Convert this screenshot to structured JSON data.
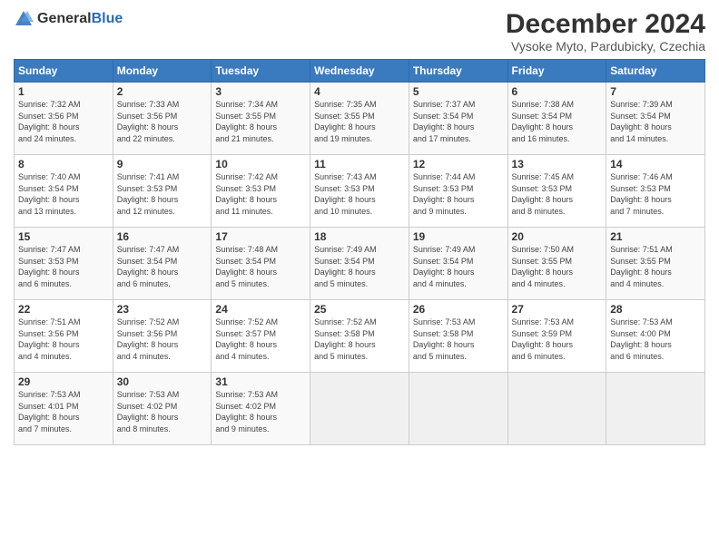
{
  "logo": {
    "general": "General",
    "blue": "Blue"
  },
  "title": {
    "main": "December 2024",
    "sub": "Vysoke Myto, Pardubicky, Czechia"
  },
  "headers": [
    "Sunday",
    "Monday",
    "Tuesday",
    "Wednesday",
    "Thursday",
    "Friday",
    "Saturday"
  ],
  "weeks": [
    [
      {
        "day": "1",
        "info": "Sunrise: 7:32 AM\nSunset: 3:56 PM\nDaylight: 8 hours\nand 24 minutes."
      },
      {
        "day": "2",
        "info": "Sunrise: 7:33 AM\nSunset: 3:56 PM\nDaylight: 8 hours\nand 22 minutes."
      },
      {
        "day": "3",
        "info": "Sunrise: 7:34 AM\nSunset: 3:55 PM\nDaylight: 8 hours\nand 21 minutes."
      },
      {
        "day": "4",
        "info": "Sunrise: 7:35 AM\nSunset: 3:55 PM\nDaylight: 8 hours\nand 19 minutes."
      },
      {
        "day": "5",
        "info": "Sunrise: 7:37 AM\nSunset: 3:54 PM\nDaylight: 8 hours\nand 17 minutes."
      },
      {
        "day": "6",
        "info": "Sunrise: 7:38 AM\nSunset: 3:54 PM\nDaylight: 8 hours\nand 16 minutes."
      },
      {
        "day": "7",
        "info": "Sunrise: 7:39 AM\nSunset: 3:54 PM\nDaylight: 8 hours\nand 14 minutes."
      }
    ],
    [
      {
        "day": "8",
        "info": "Sunrise: 7:40 AM\nSunset: 3:54 PM\nDaylight: 8 hours\nand 13 minutes."
      },
      {
        "day": "9",
        "info": "Sunrise: 7:41 AM\nSunset: 3:53 PM\nDaylight: 8 hours\nand 12 minutes."
      },
      {
        "day": "10",
        "info": "Sunrise: 7:42 AM\nSunset: 3:53 PM\nDaylight: 8 hours\nand 11 minutes."
      },
      {
        "day": "11",
        "info": "Sunrise: 7:43 AM\nSunset: 3:53 PM\nDaylight: 8 hours\nand 10 minutes."
      },
      {
        "day": "12",
        "info": "Sunrise: 7:44 AM\nSunset: 3:53 PM\nDaylight: 8 hours\nand 9 minutes."
      },
      {
        "day": "13",
        "info": "Sunrise: 7:45 AM\nSunset: 3:53 PM\nDaylight: 8 hours\nand 8 minutes."
      },
      {
        "day": "14",
        "info": "Sunrise: 7:46 AM\nSunset: 3:53 PM\nDaylight: 8 hours\nand 7 minutes."
      }
    ],
    [
      {
        "day": "15",
        "info": "Sunrise: 7:47 AM\nSunset: 3:53 PM\nDaylight: 8 hours\nand 6 minutes."
      },
      {
        "day": "16",
        "info": "Sunrise: 7:47 AM\nSunset: 3:54 PM\nDaylight: 8 hours\nand 6 minutes."
      },
      {
        "day": "17",
        "info": "Sunrise: 7:48 AM\nSunset: 3:54 PM\nDaylight: 8 hours\nand 5 minutes."
      },
      {
        "day": "18",
        "info": "Sunrise: 7:49 AM\nSunset: 3:54 PM\nDaylight: 8 hours\nand 5 minutes."
      },
      {
        "day": "19",
        "info": "Sunrise: 7:49 AM\nSunset: 3:54 PM\nDaylight: 8 hours\nand 4 minutes."
      },
      {
        "day": "20",
        "info": "Sunrise: 7:50 AM\nSunset: 3:55 PM\nDaylight: 8 hours\nand 4 minutes."
      },
      {
        "day": "21",
        "info": "Sunrise: 7:51 AM\nSunset: 3:55 PM\nDaylight: 8 hours\nand 4 minutes."
      }
    ],
    [
      {
        "day": "22",
        "info": "Sunrise: 7:51 AM\nSunset: 3:56 PM\nDaylight: 8 hours\nand 4 minutes."
      },
      {
        "day": "23",
        "info": "Sunrise: 7:52 AM\nSunset: 3:56 PM\nDaylight: 8 hours\nand 4 minutes."
      },
      {
        "day": "24",
        "info": "Sunrise: 7:52 AM\nSunset: 3:57 PM\nDaylight: 8 hours\nand 4 minutes."
      },
      {
        "day": "25",
        "info": "Sunrise: 7:52 AM\nSunset: 3:58 PM\nDaylight: 8 hours\nand 5 minutes."
      },
      {
        "day": "26",
        "info": "Sunrise: 7:53 AM\nSunset: 3:58 PM\nDaylight: 8 hours\nand 5 minutes."
      },
      {
        "day": "27",
        "info": "Sunrise: 7:53 AM\nSunset: 3:59 PM\nDaylight: 8 hours\nand 6 minutes."
      },
      {
        "day": "28",
        "info": "Sunrise: 7:53 AM\nSunset: 4:00 PM\nDaylight: 8 hours\nand 6 minutes."
      }
    ],
    [
      {
        "day": "29",
        "info": "Sunrise: 7:53 AM\nSunset: 4:01 PM\nDaylight: 8 hours\nand 7 minutes."
      },
      {
        "day": "30",
        "info": "Sunrise: 7:53 AM\nSunset: 4:02 PM\nDaylight: 8 hours\nand 8 minutes."
      },
      {
        "day": "31",
        "info": "Sunrise: 7:53 AM\nSunset: 4:02 PM\nDaylight: 8 hours\nand 9 minutes."
      },
      {
        "day": "",
        "info": ""
      },
      {
        "day": "",
        "info": ""
      },
      {
        "day": "",
        "info": ""
      },
      {
        "day": "",
        "info": ""
      }
    ]
  ]
}
